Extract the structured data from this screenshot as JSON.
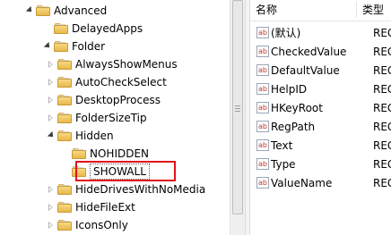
{
  "tree": {
    "items": [
      {
        "label": "Advanced",
        "level": 0,
        "expander": "open"
      },
      {
        "label": "DelayedApps",
        "level": 1,
        "expander": "none"
      },
      {
        "label": "Folder",
        "level": 1,
        "expander": "open"
      },
      {
        "label": "AlwaysShowMenus",
        "level": 2,
        "expander": "closed"
      },
      {
        "label": "AutoCheckSelect",
        "level": 2,
        "expander": "closed"
      },
      {
        "label": "DesktopProcess",
        "level": 2,
        "expander": "closed"
      },
      {
        "label": "FolderSizeTip",
        "level": 2,
        "expander": "closed"
      },
      {
        "label": "Hidden",
        "level": 2,
        "expander": "open"
      },
      {
        "label": "NOHIDDEN",
        "level": 3,
        "expander": "none"
      },
      {
        "label": "SHOWALL",
        "level": 3,
        "expander": "none",
        "selected": true
      },
      {
        "label": "HideDrivesWithNoMedia",
        "level": 2,
        "expander": "closed"
      },
      {
        "label": "HideFileExt",
        "level": 2,
        "expander": "closed"
      },
      {
        "label": "IconsOnly",
        "level": 2,
        "expander": "closed"
      }
    ]
  },
  "list": {
    "columns": {
      "name": "名称",
      "type": "类型"
    },
    "icon_text": "ab",
    "rows": [
      {
        "name": "(默认)",
        "type": "REG_SZ"
      },
      {
        "name": "CheckedValue",
        "type": "REG_DWORD"
      },
      {
        "name": "DefaultValue",
        "type": "REG_DWORD"
      },
      {
        "name": "HelpID",
        "type": "REG_SZ"
      },
      {
        "name": "HKeyRoot",
        "type": "REG_DWORD"
      },
      {
        "name": "RegPath",
        "type": "REG_SZ"
      },
      {
        "name": "Text",
        "type": "REG_SZ"
      },
      {
        "name": "Type",
        "type": "REG_SZ"
      },
      {
        "name": "ValueName",
        "type": "REG_SZ"
      }
    ]
  },
  "colors": {
    "highlight_border": "#e0141b",
    "folder": "#f0c75e"
  }
}
